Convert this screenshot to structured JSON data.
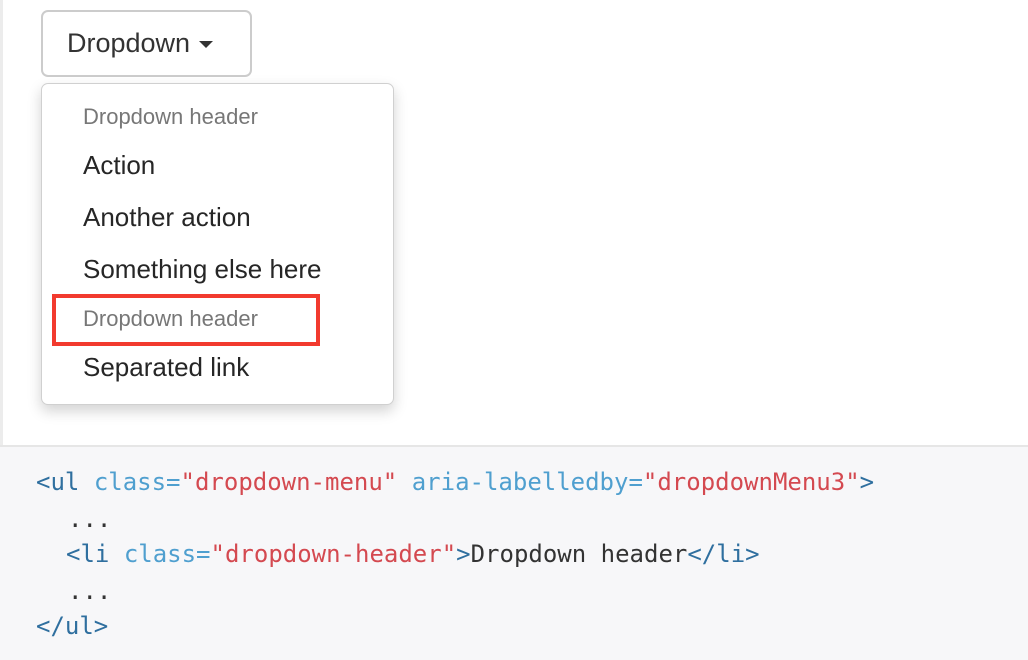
{
  "dropdown": {
    "toggle_label": "Dropdown",
    "menu": [
      {
        "kind": "header",
        "label": "Dropdown header"
      },
      {
        "kind": "item",
        "label": "Action"
      },
      {
        "kind": "item",
        "label": "Another action"
      },
      {
        "kind": "item",
        "label": "Something else here"
      },
      {
        "kind": "header",
        "label": "Dropdown header",
        "highlighted": true
      },
      {
        "kind": "item",
        "label": "Separated link"
      }
    ]
  },
  "highlight_color": "#f23a2e",
  "code": {
    "line1": {
      "open": "<ul",
      "attr1": "class=",
      "val1": "\"dropdown-menu\"",
      "attr2": "aria-labelledby=",
      "val2": "\"dropdownMenu3\"",
      "close": ">"
    },
    "line2": "...",
    "line3": {
      "open": "<li",
      "attr1": "class=",
      "val1": "\"dropdown-header\"",
      "close": ">",
      "text": "Dropdown header",
      "end": "</li>"
    },
    "line4": "...",
    "line5": "</ul>"
  },
  "colors": {
    "tag": "#2f6f9f",
    "attribute": "#4f9fcf",
    "string": "#d44950",
    "code_background": "#f7f7f9"
  }
}
